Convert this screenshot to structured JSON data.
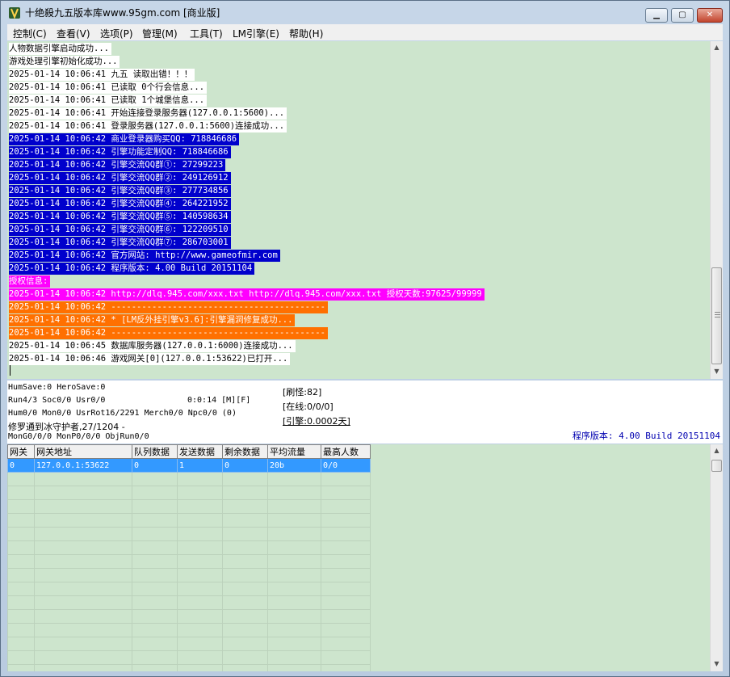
{
  "window": {
    "title": "十绝殺九五版本库www.95gm.com [商业版]"
  },
  "menu": [
    "控制(C)",
    "查看(V)",
    "选项(P)",
    "管理(M)",
    "工具(T)",
    "LM引擎(E)",
    "帮助(H)"
  ],
  "log": [
    {
      "text": "人物数据引擎启动成功...",
      "style": "w"
    },
    {
      "text": "游戏处理引擎初始化成功...",
      "style": "w"
    },
    {
      "text": "2025-01-14 10:06:41 九五 读取出错！！！",
      "style": "w"
    },
    {
      "text": "2025-01-14 10:06:41 已读取 0个行会信息...",
      "style": "w"
    },
    {
      "text": "2025-01-14 10:06:41 已读取 1个城堡信息...",
      "style": "w"
    },
    {
      "text": "2025-01-14 10:06:41 开始连接登录服务器(127.0.0.1:5600)...",
      "style": "w"
    },
    {
      "text": "2025-01-14 10:06:41 登录服务器(127.0.0.1:5600)连接成功...",
      "style": "w"
    },
    {
      "text": "2025-01-14 10:06:42 商业登录器购买QQ: 718846686",
      "style": "b"
    },
    {
      "text": "2025-01-14 10:06:42 引擎功能定制QQ: 718846686",
      "style": "b"
    },
    {
      "text": "2025-01-14 10:06:42 引擎交流QQ群①: 27299223",
      "style": "b"
    },
    {
      "text": "2025-01-14 10:06:42 引擎交流QQ群②: 249126912",
      "style": "b"
    },
    {
      "text": "2025-01-14 10:06:42 引擎交流QQ群③: 277734856",
      "style": "b"
    },
    {
      "text": "2025-01-14 10:06:42 引擎交流QQ群④: 264221952",
      "style": "b"
    },
    {
      "text": "2025-01-14 10:06:42 引擎交流QQ群⑤: 140598634",
      "style": "b"
    },
    {
      "text": "2025-01-14 10:06:42 引擎交流QQ群⑥: 122209510",
      "style": "b"
    },
    {
      "text": "2025-01-14 10:06:42 引擎交流QQ群⑦: 286703001",
      "style": "b"
    },
    {
      "text": "2025-01-14 10:06:42 官方网站: http://www.gameofmir.com",
      "style": "b"
    },
    {
      "text": "2025-01-14 10:06:42 程序版本: 4.00 Build 20151104",
      "style": "b"
    },
    {
      "text": "授权信息:",
      "style": "m"
    },
    {
      "text": "2025-01-14 10:06:42 http://dlq.945.com/xxx.txt http://dlq.945.com/xxx.txt 授权天数:97625/99999",
      "style": "m"
    },
    {
      "text": "2025-01-14 10:06:42 ------------------------------------------",
      "style": "o"
    },
    {
      "text": "2025-01-14 10:06:42 * [LM反外挂引擎v3.6]:引擎漏洞修复成功...",
      "style": "o"
    },
    {
      "text": "2025-01-14 10:06:42 ------------------------------------------",
      "style": "o"
    },
    {
      "text": "2025-01-14 10:06:45 数据库服务器(127.0.0.1:6000)连接成功...",
      "style": "w"
    },
    {
      "text": "2025-01-14 10:06:46 游戏网关[0](127.0.0.1:53622)已打开...",
      "style": "w"
    }
  ],
  "status": {
    "save": "HumSave:0 HeroSave:0",
    "run": "Run4/3 Soc0/0 Usr0/0",
    "time": "0:0:14 [M][F]",
    "hum": "Hum0/0 Mon0/0 UsrRot16/2291 Merch0/0 Npc0/0 (0)",
    "map": "修罗通到冰守护者,27/1204 -",
    "mon": "MonG0/0/0 MonP0/0/0 ObjRun0/0",
    "refresh": "[刷怪:82]",
    "online": "[在线:0/0/0]",
    "engine": "[引擎:0.0002天]",
    "version": "程序版本: 4.00 Build 20151104"
  },
  "grid": {
    "columns": [
      "网关",
      "网关地址",
      "队列数据",
      "发送数据",
      "剩余数据",
      "平均流量",
      "最高人数"
    ],
    "rows": [
      [
        "0",
        "127.0.0.1:53622",
        "0",
        "1",
        "0",
        "20b",
        "0/0"
      ]
    ]
  },
  "colors": {
    "log_background": "#cde5cd",
    "blue_highlight": "#0000cc",
    "magenta_highlight": "#ff00ff",
    "orange_highlight": "#ff7000",
    "grid_selected": "#3399ff"
  }
}
